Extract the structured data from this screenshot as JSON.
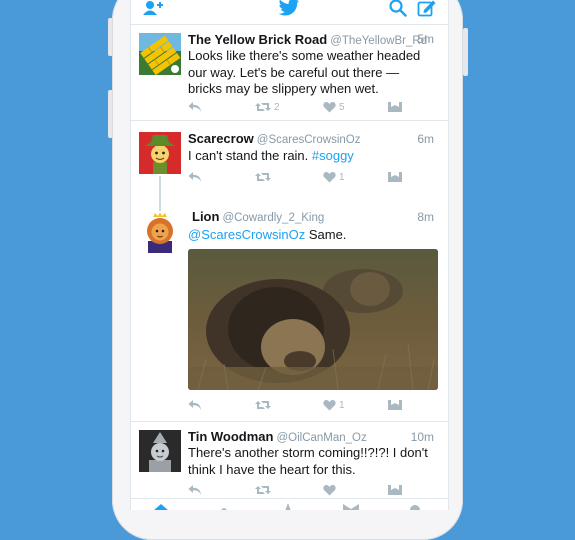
{
  "app": {
    "accent": "#1da1f2",
    "background": "#4a9ad9"
  },
  "navbar": {
    "add_user_icon": "add-user-icon",
    "logo": "twitter-bird-icon",
    "search_icon": "search-icon",
    "compose_icon": "compose-icon"
  },
  "tweets": [
    {
      "name": "The Yellow Brick Road",
      "handle": "@TheYellowBr_Rd",
      "time": "5m",
      "text": "Looks like there's some weather headed our way. Let's be careful out there — bricks may be slippery when wet.",
      "retweets": "2",
      "likes": "5"
    },
    {
      "name": "Scarecrow",
      "handle": "@ScaresCrowsinOz",
      "time": "6m",
      "text_plain": "I can't stand the rain. ",
      "hashtag": "#soggy",
      "retweets": "",
      "likes": "1"
    },
    {
      "name": "Lion",
      "handle": "@Cowardly_2_King",
      "time": "8m",
      "mention": "@ScaresCrowsinOz",
      "text_plain": " Same.",
      "retweets": "",
      "likes": "1"
    },
    {
      "name": "Tin Woodman",
      "handle": "@OilCanMan_Oz",
      "time": "10m",
      "text": "There's another storm coming!!?!?! I don't think I have the heart for this.",
      "retweets": "",
      "likes": ""
    }
  ]
}
